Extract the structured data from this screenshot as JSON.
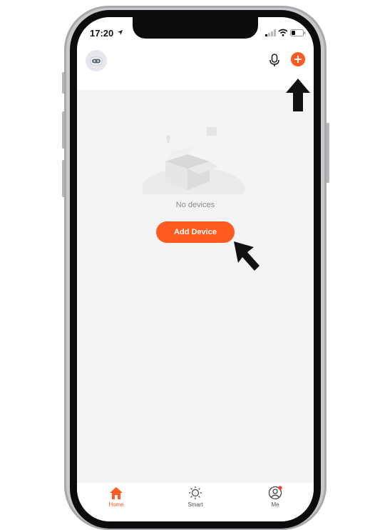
{
  "status_bar": {
    "time": "17:20"
  },
  "header": {
    "avatar_icon": "robot-avatar-icon",
    "mic_icon": "microphone-icon",
    "add_icon": "plus-circle-icon"
  },
  "empty_state": {
    "message": "No devices",
    "button_label": "Add Device",
    "illustration": "empty-box-illustration"
  },
  "tab_bar": {
    "tabs": [
      {
        "label": "Home",
        "icon": "home-icon",
        "active": true
      },
      {
        "label": "Smart",
        "icon": "sun-icon",
        "active": false
      },
      {
        "label": "Me",
        "icon": "user-circle-icon",
        "active": false,
        "badge": true
      }
    ]
  },
  "colors": {
    "accent": "#ff5a1f",
    "background": "#f4f4f4",
    "annotation_arrow": "#111111"
  }
}
